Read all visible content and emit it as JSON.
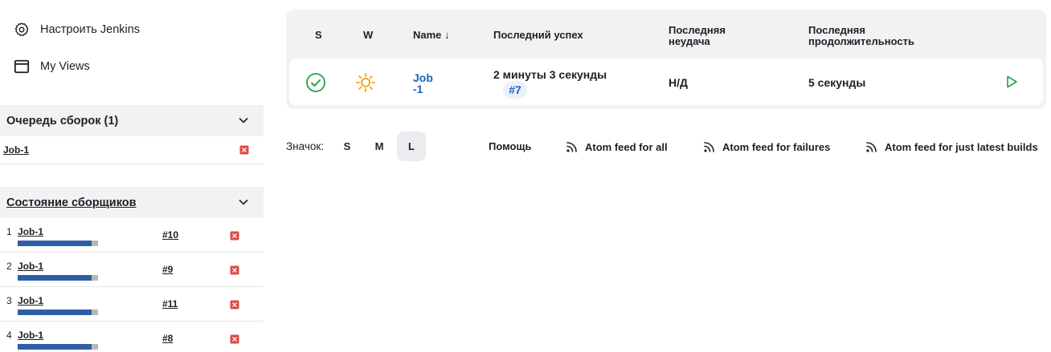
{
  "sidebar": {
    "nav": [
      {
        "label": "Настроить Jenkins",
        "icon": "gear-icon"
      },
      {
        "label": "My Views",
        "icon": "window-icon"
      }
    ],
    "queue": {
      "title": "Очередь сборок (1)",
      "items": [
        {
          "job": "Job-1"
        }
      ]
    },
    "executors": {
      "title": "Состояние сборщиков",
      "items": [
        {
          "num": "1",
          "job": "Job-1",
          "build": "#10",
          "progress": 0.92
        },
        {
          "num": "2",
          "job": "Job-1",
          "build": "#9",
          "progress": 0.92
        },
        {
          "num": "3",
          "job": "Job-1",
          "build": "#11",
          "progress": 0.92
        },
        {
          "num": "4",
          "job": "Job-1",
          "build": "#8",
          "progress": 0.92
        }
      ]
    }
  },
  "table": {
    "headers": {
      "s": "S",
      "w": "W",
      "name": "Name ↓",
      "last_success": "Последний успех",
      "last_failure_1": "Последняя",
      "last_failure_2": "неудача",
      "last_duration_1": "Последняя",
      "last_duration_2": "продолжительность"
    },
    "rows": [
      {
        "status_icon": "success-check-icon",
        "weather_icon": "sunny-icon",
        "name_1": "Job",
        "name_2": "-1",
        "last_success": "2 минуты 3 секунды",
        "last_success_build": "#7",
        "last_failure": "Н/Д",
        "last_duration": "5 секунды",
        "action_icon": "play-icon"
      }
    ]
  },
  "footer": {
    "icon_label": "Значок:",
    "sizes": [
      "S",
      "M",
      "L"
    ],
    "active_size": "L",
    "help": "Помощь",
    "feeds": [
      "Atom feed for all",
      "Atom feed for failures",
      "Atom feed for just latest builds"
    ]
  },
  "colors": {
    "accent_link": "#1a64b5",
    "success": "#1ea446",
    "weather": "#f0a30a",
    "progress_fill": "#2e5fa6",
    "stop": "#e04848"
  }
}
